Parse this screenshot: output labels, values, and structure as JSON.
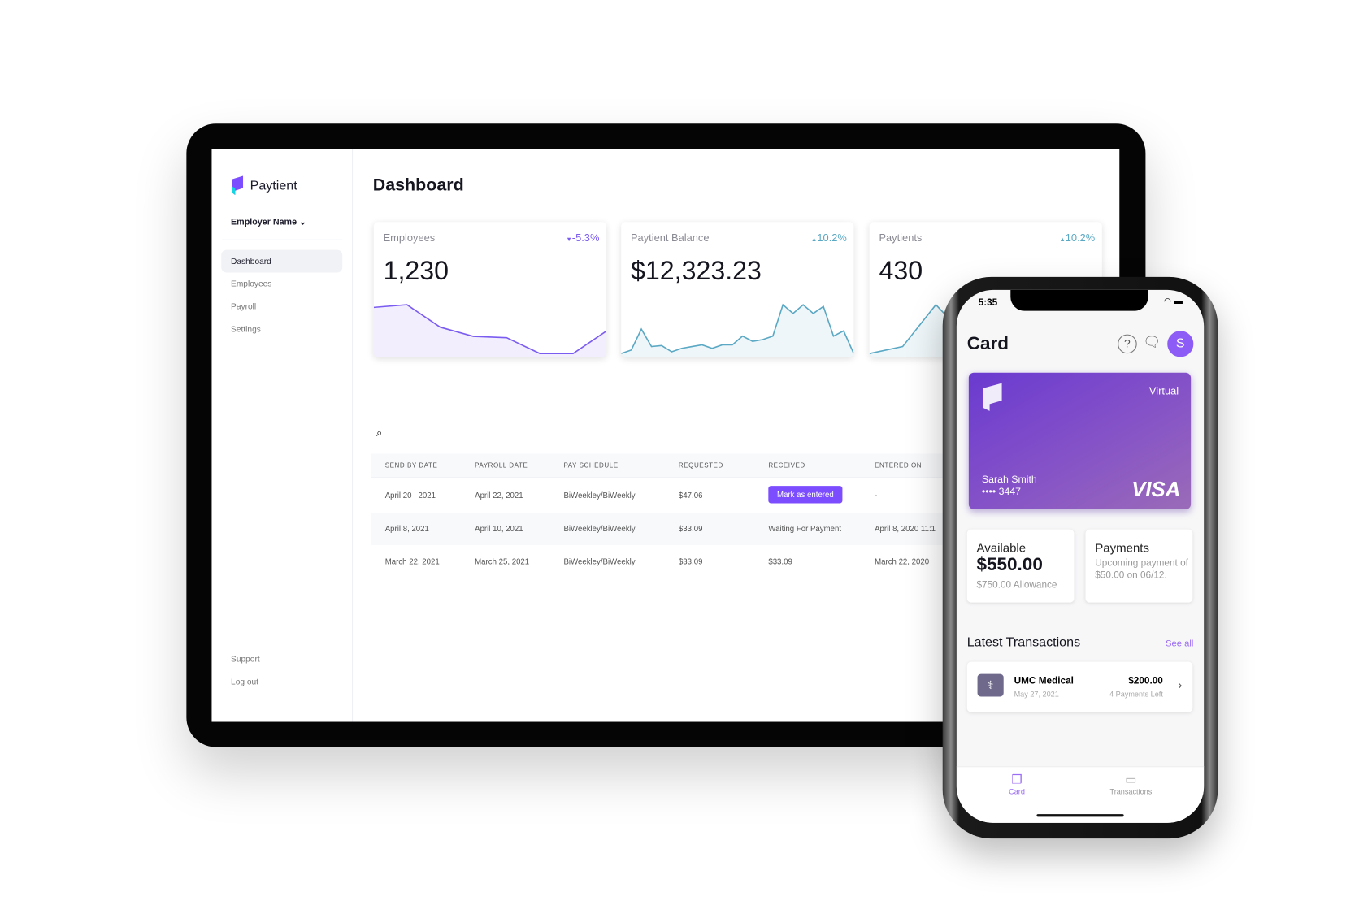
{
  "sidebar": {
    "brand": "Paytient",
    "employer": "Employer Name",
    "items": [
      {
        "label": "Dashboard",
        "active": true
      },
      {
        "label": "Employees"
      },
      {
        "label": "Payroll"
      },
      {
        "label": "Settings"
      }
    ],
    "footer": [
      {
        "label": "Support"
      },
      {
        "label": "Log out"
      }
    ]
  },
  "main": {
    "title": "Dashboard",
    "stats": [
      {
        "label": "Employees",
        "value": "1,230",
        "change": "-5.3%",
        "direction": "down",
        "color": "#7b5cf0",
        "trend": [
          10,
          10.2,
          8.5,
          7.8,
          7.7,
          6.5,
          6.5,
          8.2
        ]
      },
      {
        "label": "Paytient Balance",
        "value": "$12,323.23",
        "change": "10.2%",
        "direction": "up",
        "color": "#5aa8c4",
        "trend": [
          1,
          2,
          8,
          3,
          3.3,
          1.5,
          2.5,
          3,
          3.5,
          2.5,
          3.5,
          3.5,
          6,
          4.5,
          5,
          6,
          15,
          12.5,
          15,
          12.5,
          14.5,
          6,
          7.5,
          1
        ]
      },
      {
        "label": "Paytients",
        "value": "430",
        "change": "10.2%",
        "direction": "up",
        "color": "#5aa8c4",
        "trend": [
          1,
          2,
          8,
          3,
          3.3,
          1.5,
          2.5,
          3
        ]
      }
    ],
    "table": {
      "columns": [
        "SEND BY DATE",
        "PAYROLL DATE",
        "PAY SCHEDULE",
        "REQUESTED",
        "RECEIVED",
        "ENTERED ON"
      ],
      "rows": [
        [
          "April 20 , 2021",
          "April 22, 2021",
          "BiWeekley/BiWeekly",
          "$47.06",
          "Mark as entered",
          "-"
        ],
        [
          "April 8, 2021",
          "April 10, 2021",
          "BiWeekley/BiWeekly",
          "$33.09",
          "Waiting For Payment",
          "April 8, 2020 11:1"
        ],
        [
          "March 22, 2021",
          "March 25, 2021",
          "BiWeekley/BiWeekly",
          "$33.09",
          "$33.09",
          "March 22, 2020"
        ]
      ]
    }
  },
  "phone": {
    "time": "5:35",
    "title": "Card",
    "avatar": "S",
    "card": {
      "type": "Virtual",
      "name": "Sarah Smith",
      "number": "•••• 3447",
      "network": "VISA"
    },
    "available": {
      "label": "Available",
      "amount": "$550.00",
      "sub": "$750.00 Allowance"
    },
    "payments": {
      "label": "Payments",
      "text": "Upcoming payment of $50.00 on 06/12."
    },
    "transactions": {
      "title": "Latest Transactions",
      "see_all": "See all",
      "items": [
        {
          "merchant": "UMC Medical",
          "date": "May 27, 2021",
          "amount": "$200.00",
          "note": "4 Payments Left"
        }
      ]
    },
    "tabs": [
      {
        "label": "Card",
        "active": true
      },
      {
        "label": "Transactions"
      }
    ]
  },
  "colors": {
    "accent": "#7c4dff",
    "teal": "#5aa8c4"
  }
}
